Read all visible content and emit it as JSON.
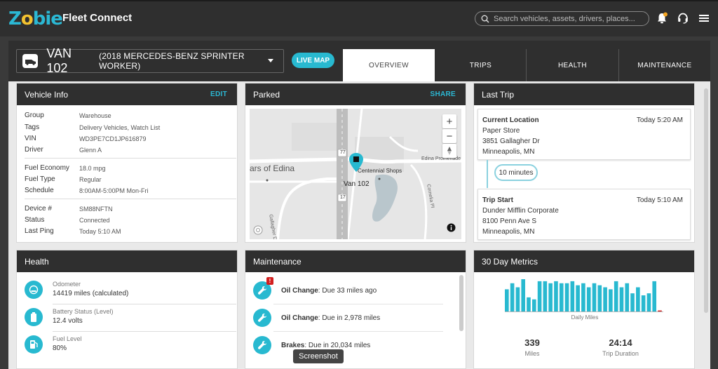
{
  "app": {
    "logo_text": "Z",
    "logo_o": "o",
    "logo_rest": "bie",
    "title": "Fleet Connect"
  },
  "search": {
    "placeholder": "Search vehicles, assets, drivers, places..."
  },
  "icons": {
    "search": "search-icon",
    "bell": "bell-icon",
    "support": "headset-icon",
    "menu": "hamburger-menu-icon",
    "van": "van-icon",
    "dropdown": "caret-down-icon"
  },
  "colors": {
    "accent": "#28b9d0",
    "alert": "#d32020",
    "bar": "#28b9d0"
  },
  "vehicle": {
    "name": "VAN 102",
    "model": "(2018 MERCEDES-BENZ SPRINTER WORKER)",
    "live_map": "LIVE MAP"
  },
  "tabs": [
    "OVERVIEW",
    "TRIPS",
    "HEALTH",
    "MAINTENANCE"
  ],
  "vehicle_info": {
    "title": "Vehicle Info",
    "edit": "EDIT",
    "rows": [
      {
        "label": "Group",
        "value": "Warehouse"
      },
      {
        "label": "Tags",
        "value": "Delivery Vehicles, Watch List"
      },
      {
        "label": "VIN",
        "value": "WD3PE7CD1JP616879"
      },
      {
        "label": "Driver",
        "value": "Glenn A"
      },
      {
        "label": "Fuel Economy",
        "value": "18.0 mpg"
      },
      {
        "label": "Fuel Type",
        "value": "Regular"
      },
      {
        "label": "Schedule",
        "value": "8:00AM-5:00PM Mon-Fri"
      },
      {
        "label": "Device #",
        "value": "SM88NFTN"
      },
      {
        "label": "Status",
        "value": "Connected"
      },
      {
        "label": "Last Ping",
        "value": "Today 5:10 AM"
      }
    ]
  },
  "parked": {
    "title": "Parked",
    "share": "SHARE",
    "map": {
      "place_1": "ars of Edina",
      "place_2": "Centennial Shops",
      "place_3": "Edina Promenade",
      "road_1": "77",
      "road_2": "17",
      "street_1": "Gallagher Dr",
      "street_2": "Cornelia Pl",
      "vehicle_label": "Van 102",
      "zoom_in": "+",
      "zoom_out": "−"
    }
  },
  "last_trip": {
    "title": "Last Trip",
    "current": {
      "title": "Current Location",
      "time": "Today 5:20 AM",
      "line1": "Paper Store",
      "line2": "3851 Gallagher Dr",
      "line3": "Minneapolis, MN"
    },
    "duration": "10 minutes",
    "start": {
      "title": "Trip Start",
      "time": "Today 5:10 AM",
      "line1": "Dunder Mifflin Corporate",
      "line2": "8100 Penn Ave S",
      "line3": "Minneapolis, MN"
    }
  },
  "health": {
    "title": "Health",
    "items": [
      {
        "label": "Odometer",
        "value": "14419 miles (calculated)"
      },
      {
        "label": "Battery Status (Level)",
        "value": "12.4 volts"
      },
      {
        "label": "Fuel Level",
        "value": "80%"
      }
    ]
  },
  "maintenance": {
    "title": "Maintenance",
    "items": [
      {
        "name": "Oil Change",
        "detail": ": Due 33 miles ago",
        "badge": "!"
      },
      {
        "name": "Oil Change",
        "detail": ": Due in 2,978 miles",
        "badge": ""
      },
      {
        "name": "Brakes",
        "detail": ": Due in 20,034 miles",
        "badge": ""
      }
    ]
  },
  "metrics": {
    "title": "30 Day Metrics",
    "chart_label": "Daily Miles",
    "miles_value": "339",
    "miles_label": "Miles",
    "duration_value": "24:14",
    "duration_label": "Trip Duration"
  },
  "chart_data": {
    "type": "bar",
    "values": [
      11,
      14,
      12,
      16,
      7,
      6,
      15,
      15,
      14,
      15,
      14,
      14,
      15,
      13,
      14,
      12,
      14,
      13,
      12,
      11,
      15,
      12,
      14,
      9,
      12,
      8,
      9,
      15,
      0.5
    ],
    "ylim": [
      0,
      16
    ],
    "xlabel": "Daily Miles"
  },
  "tooltip": "Screenshot"
}
